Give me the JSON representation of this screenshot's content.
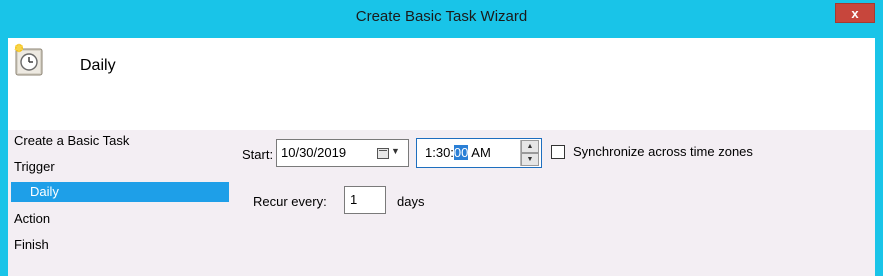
{
  "window": {
    "title": "Create Basic Task Wizard",
    "close_label": "x"
  },
  "header": {
    "title": "Daily",
    "icon": "clock-task-icon"
  },
  "nav": {
    "items": [
      {
        "label": "Create a Basic Task",
        "selected": false
      },
      {
        "label": "Trigger",
        "selected": false
      },
      {
        "label": "Daily",
        "selected": true
      },
      {
        "label": "Action",
        "selected": false
      },
      {
        "label": "Finish",
        "selected": false
      }
    ]
  },
  "form": {
    "start_label": "Start:",
    "date_value": "10/30/2019",
    "time_before": "1:30:",
    "time_selected": "00",
    "time_after": " AM",
    "sync_label": "Synchronize across time zones",
    "sync_checked": false,
    "recur_label": "Recur every:",
    "recur_value": "1",
    "recur_unit": "days"
  },
  "colors": {
    "title_bar": "#19c4e8",
    "close_button": "#c7463c",
    "selection": "#1e9fe8",
    "content_bg": "#f3eef3"
  }
}
